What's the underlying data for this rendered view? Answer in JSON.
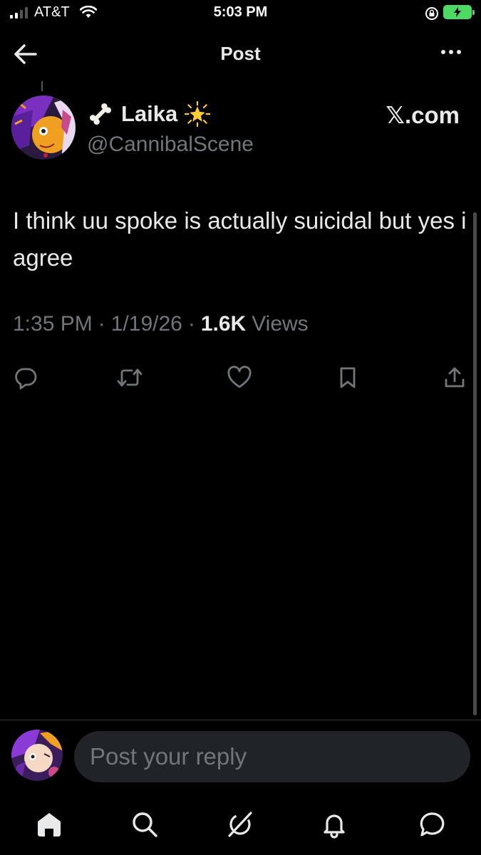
{
  "status_bar": {
    "carrier": "AT&T",
    "time": "5:03 PM",
    "battery_state": "charging"
  },
  "header": {
    "title": "Post",
    "back_icon": "arrow-left-icon",
    "more_icon": "more-horizontal-icon"
  },
  "post": {
    "display_name": "Laika",
    "handle": "@CannibalScene",
    "source_label": "𝕏.com",
    "text": "I think uu spoke is actually suicidal but yes i agree",
    "time": "1:35 PM",
    "date": "1/19/26",
    "views_count": "1.6K",
    "views_label": "Views",
    "separator": "·"
  },
  "actions": [
    {
      "name": "reply",
      "icon": "reply-icon"
    },
    {
      "name": "repost",
      "icon": "repost-icon"
    },
    {
      "name": "like",
      "icon": "heart-icon"
    },
    {
      "name": "bookmark",
      "icon": "bookmark-icon"
    },
    {
      "name": "share",
      "icon": "share-icon"
    }
  ],
  "reply": {
    "placeholder": "Post your reply"
  },
  "tabbar": {
    "items": [
      "home-icon",
      "search-icon",
      "grok-icon",
      "notifications-icon",
      "messages-icon"
    ]
  },
  "colors": {
    "background": "#000000",
    "text_primary": "#e7e9ea",
    "text_secondary": "#71767b",
    "input_background": "#202327",
    "battery": "#4cd964"
  }
}
